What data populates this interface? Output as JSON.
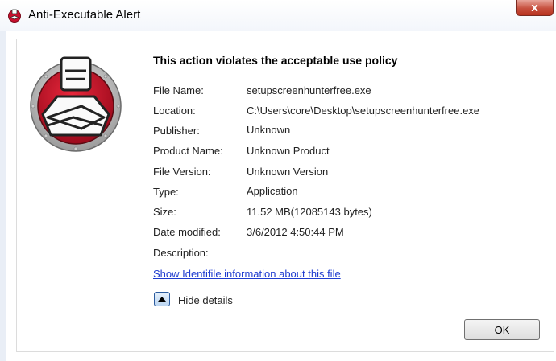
{
  "window": {
    "title": "Anti-Executable Alert",
    "close_label": "x"
  },
  "alert": {
    "heading": "This action violates the acceptable use policy",
    "fields": [
      {
        "label": "File Name:",
        "value": "setupscreenhunterfree.exe"
      },
      {
        "label": "Location:",
        "value": "C:\\Users\\core\\Desktop\\setupscreenhunterfree.exe"
      },
      {
        "label": "Publisher:",
        "value": "Unknown"
      },
      {
        "label": "Product Name:",
        "value": "Unknown Product"
      },
      {
        "label": "File Version:",
        "value": "Unknown Version"
      },
      {
        "label": "Type:",
        "value": "Application"
      },
      {
        "label": "Size:",
        "value": "11.52 MB(12085143 bytes)"
      },
      {
        "label": "Date modified:",
        "value": "3/6/2012 4:50:44 PM"
      },
      {
        "label": "Description:",
        "value": ""
      }
    ],
    "details_link": "Show Identifile information about this file",
    "toggle_label": "Hide details",
    "ok_label": "OK"
  },
  "icons": {
    "title_icon": "anti-executable-guard-icon",
    "logo": "anti-executable-guard-logo",
    "toggle": "triangle-up-icon"
  },
  "colors": {
    "logo_red": "#c8102e",
    "link": "#1f3ccf",
    "close_button": "#c7503f"
  }
}
